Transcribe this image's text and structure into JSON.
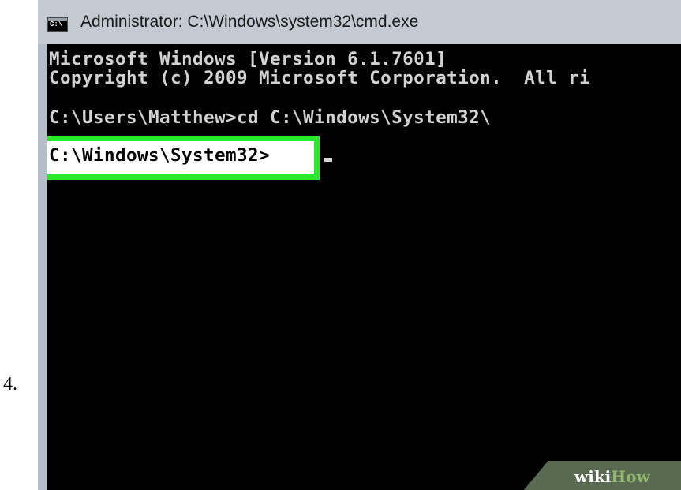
{
  "step": {
    "number": "4."
  },
  "window": {
    "icon_label": "C:\\",
    "title": "Administrator: C:\\Windows\\system32\\cmd.exe"
  },
  "console": {
    "lines": [
      "Microsoft Windows [Version 6.1.7601]",
      "Copyright (c) 2009 Microsoft Corporation.  All ri",
      "C:\\Users\\Matthew>cd C:\\Windows\\System32\\"
    ],
    "current_prompt": "C:\\Windows\\System32>"
  },
  "watermark": {
    "part_a": "wiki",
    "part_b": "How"
  },
  "colors": {
    "console_background": "#000000",
    "console_text": "#d2d2d2",
    "highlight_border": "#2ee82e",
    "title_bar": "#c3cad1"
  }
}
